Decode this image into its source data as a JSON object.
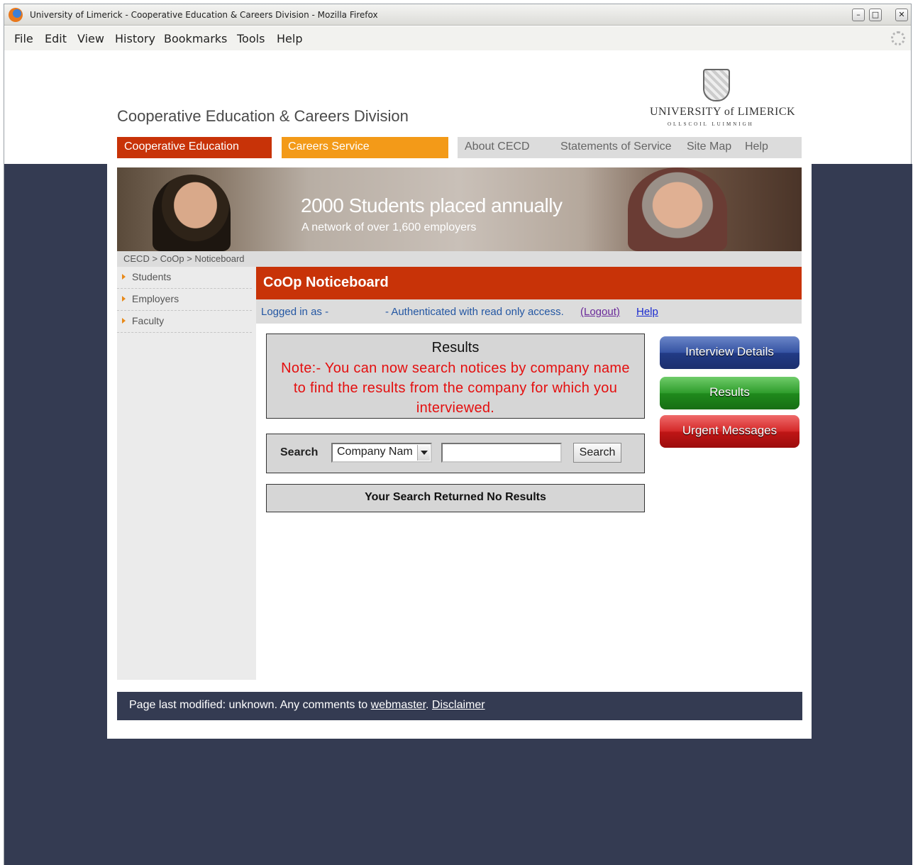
{
  "window": {
    "title": "University of Limerick - Cooperative Education & Careers Division - Mozilla Firefox",
    "minimize": "–",
    "maximize": "□",
    "close": "✕"
  },
  "menubar": {
    "items": [
      "File",
      "Edit",
      "View",
      "History",
      "Bookmarks",
      "Tools",
      "Help"
    ]
  },
  "header": {
    "site_title": "Cooperative Education & Careers Division",
    "university_name": "UNIVERSITY of LIMERICK",
    "university_sub": "OLLSCOIL LUIMNIGH"
  },
  "nav": {
    "coop": "Cooperative Education",
    "careers": "Careers Service",
    "about": "About CECD",
    "statements": "Statements of Service",
    "sitemap": "Site Map",
    "help": "Help"
  },
  "banner": {
    "headline": "2000 Students placed annually",
    "subline": "A network of over 1,600 employers"
  },
  "breadcrumb": "CECD > CoOp > Noticeboard",
  "sidebar": {
    "items": [
      {
        "label": "Students"
      },
      {
        "label": "Employers"
      },
      {
        "label": "Faculty"
      }
    ]
  },
  "main": {
    "title": "CoOp Noticeboard",
    "logged_in_as": "Logged in as -",
    "auth_text": "- Authenticated with read only access.",
    "logout": "(Logout)",
    "help": "Help",
    "results_title": "Results",
    "results_note": "Note:- You can now search notices by company name to find the results from the company for which you interviewed.",
    "search_label": "Search",
    "search_select_value": "Company Nam",
    "search_input_value": "",
    "search_button": "Search",
    "no_results": "Your Search Returned No Results"
  },
  "side_buttons": {
    "interview": "Interview Details",
    "results": "Results",
    "urgent": "Urgent Messages"
  },
  "footer": {
    "text": "Page last modified: unknown. Any comments to",
    "webmaster": "webmaster",
    "separator": ".",
    "disclaimer": "Disclaimer"
  },
  "colors": {
    "accent_red": "#c83308",
    "accent_orange": "#f39a18",
    "dark_bg": "#343b52",
    "note_red": "#e40f0f"
  }
}
